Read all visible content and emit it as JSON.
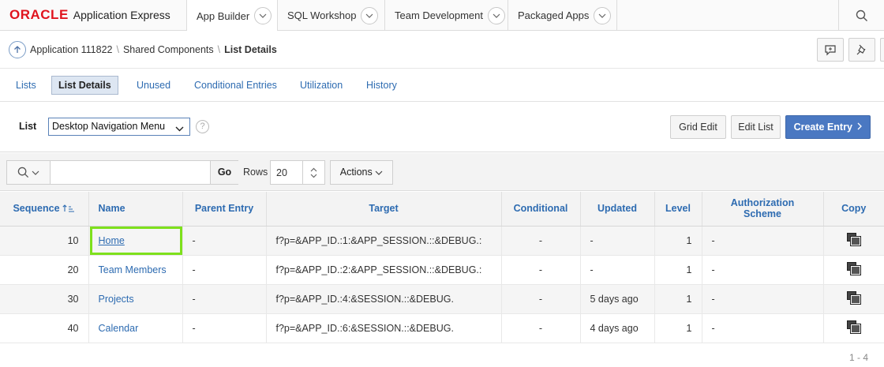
{
  "brand": {
    "oracle": "ORACLE",
    "product": "Application Express",
    "color": "#e0141e"
  },
  "topnav": {
    "tabs": [
      {
        "label": "App Builder",
        "active": true
      },
      {
        "label": "SQL Workshop",
        "active": false
      },
      {
        "label": "Team Development",
        "active": false
      },
      {
        "label": "Packaged Apps",
        "active": false
      }
    ],
    "search_icon": "search-icon"
  },
  "breadcrumb": {
    "up_icon": "arrow-up-icon",
    "items": [
      "Application 111822",
      "Shared Components",
      "List Details"
    ],
    "separator": "\\"
  },
  "header_actions": [
    "comment-icon",
    "pin-icon"
  ],
  "subtabs": [
    {
      "label": "Lists",
      "active": false
    },
    {
      "label": "List Details",
      "active": true
    },
    {
      "label": "Unused",
      "active": false
    },
    {
      "label": "Conditional Entries",
      "active": false
    },
    {
      "label": "Utilization",
      "active": false
    },
    {
      "label": "History",
      "active": false
    }
  ],
  "list_region": {
    "label": "List",
    "selected": "Desktop Navigation Menu",
    "help": "?",
    "buttons": {
      "grid_edit": "Grid Edit",
      "edit_list": "Edit List",
      "create_entry": "Create Entry"
    },
    "accent": "#4a78c2"
  },
  "toolbar": {
    "search_value": "",
    "go": "Go",
    "rows_label": "Rows",
    "rows_value": "20",
    "actions": "Actions"
  },
  "table": {
    "columns": [
      "Sequence",
      "Name",
      "Parent Entry",
      "Target",
      "Conditional",
      "Updated",
      "Level",
      "Authorization Scheme",
      "Copy"
    ],
    "rows": [
      {
        "sequence": "10",
        "name": "Home",
        "parent": "-",
        "target": "f?p=&APP_ID.:1:&APP_SESSION.::&DEBUG.:",
        "conditional": "-",
        "updated": "-",
        "level": "1",
        "auth": "-"
      },
      {
        "sequence": "20",
        "name": "Team Members",
        "parent": "-",
        "target": "f?p=&APP_ID.:2:&APP_SESSION.::&DEBUG.:",
        "conditional": "-",
        "updated": "-",
        "level": "1",
        "auth": "-"
      },
      {
        "sequence": "30",
        "name": "Projects",
        "parent": "-",
        "target": "f?p=&APP_ID.:4:&SESSION.::&DEBUG.",
        "conditional": "-",
        "updated": "5 days ago",
        "level": "1",
        "auth": "-"
      },
      {
        "sequence": "40",
        "name": "Calendar",
        "parent": "-",
        "target": "f?p=&APP_ID.:6:&SESSION.::&DEBUG.",
        "conditional": "-",
        "updated": "4 days ago",
        "level": "1",
        "auth": "-"
      }
    ],
    "pagination": "1 - 4",
    "highlight_color": "#7ee01c"
  }
}
